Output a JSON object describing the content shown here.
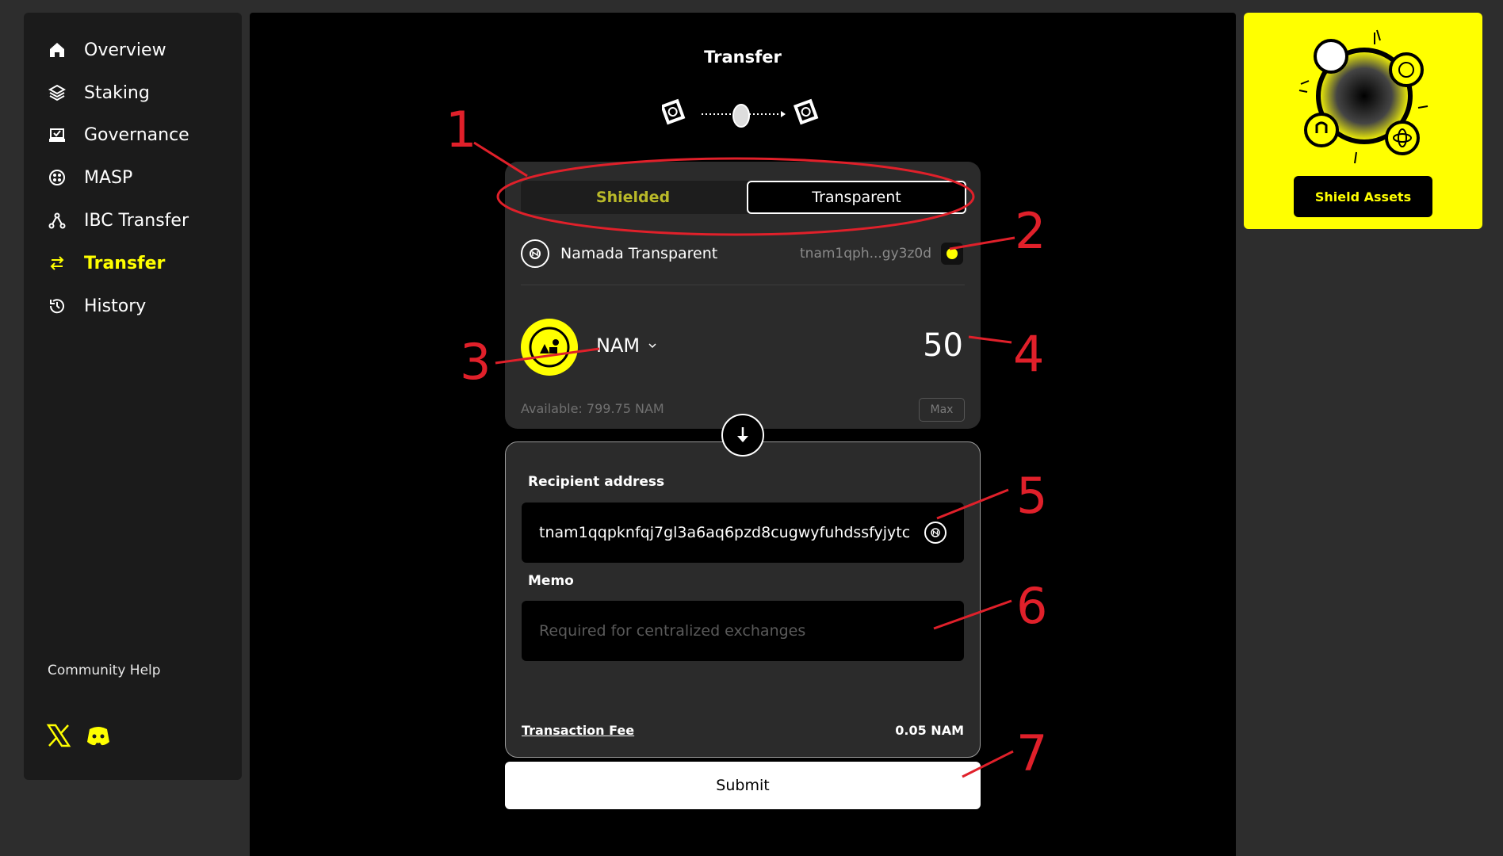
{
  "sidebar": {
    "items": [
      {
        "label": "Overview",
        "icon": "home-icon"
      },
      {
        "label": "Staking",
        "icon": "layers-icon"
      },
      {
        "label": "Governance",
        "icon": "ballot-icon"
      },
      {
        "label": "MASP",
        "icon": "masp-icon"
      },
      {
        "label": "IBC Transfer",
        "icon": "ibc-icon"
      },
      {
        "label": "Transfer",
        "icon": "transfer-icon",
        "active": true
      },
      {
        "label": "History",
        "icon": "history-icon"
      }
    ],
    "community_help": "Community Help",
    "socials": [
      "x-icon",
      "discord-icon"
    ]
  },
  "page": {
    "title": "Transfer"
  },
  "source": {
    "tabs": {
      "shielded": "Shielded",
      "transparent": "Transparent",
      "selected": "Transparent"
    },
    "account_name": "Namada Transparent",
    "account_address": "tnam1qph...gy3z0d",
    "token": "NAM",
    "amount": "50",
    "available": "Available:  799.75 NAM",
    "max_label": "Max"
  },
  "destination": {
    "recipient_label": "Recipient address",
    "recipient_value": "tnam1qqpknfqj7gl3a6aq6pzd8cugwyfuhdssfyjytc",
    "memo_label": "Memo",
    "memo_placeholder": "Required for centralized exchanges",
    "fee_label": "Transaction Fee",
    "fee_value": "0.05 NAM"
  },
  "submit_label": "Submit",
  "promo": {
    "button_label": "Shield Assets"
  },
  "annotations": [
    "1",
    "2",
    "3",
    "4",
    "5",
    "6",
    "7"
  ],
  "colors": {
    "accent": "#ffff00",
    "annotation": "#e0202a",
    "background": "#000000",
    "panel": "#2b2b2b"
  }
}
